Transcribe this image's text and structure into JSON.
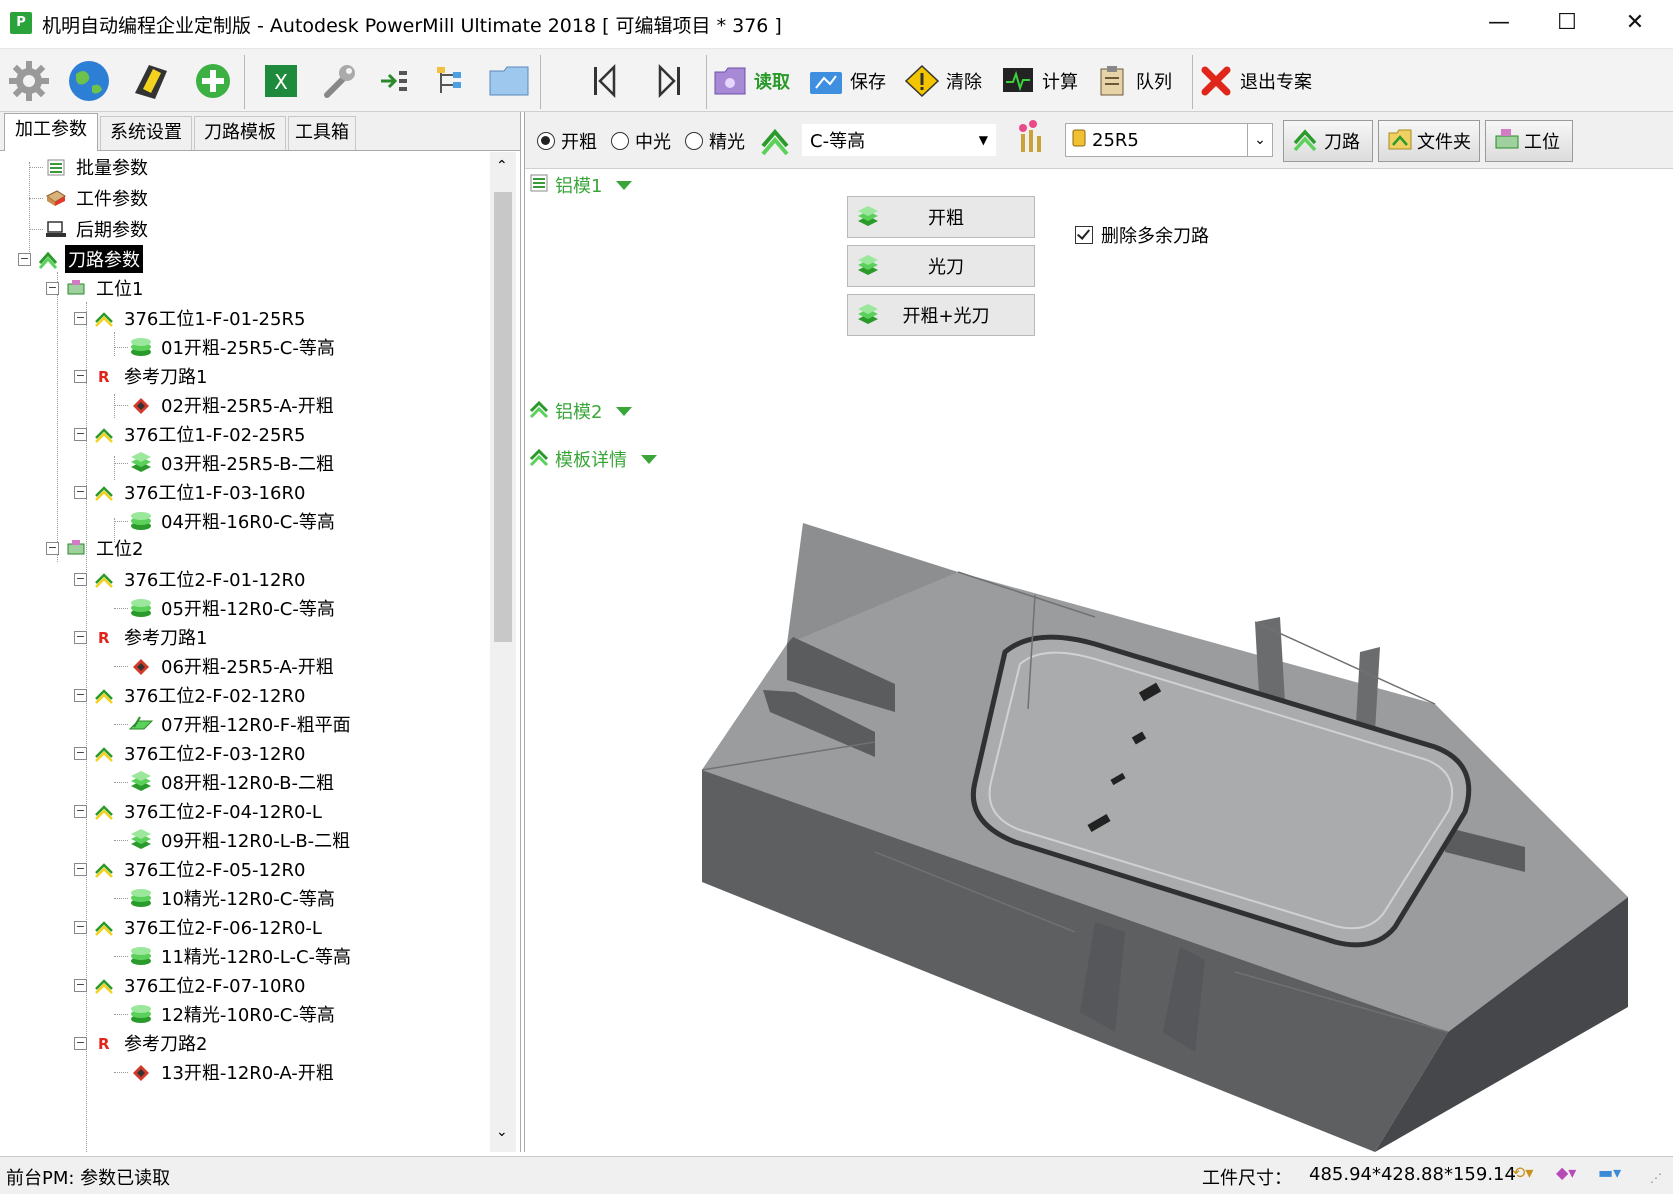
{
  "window": {
    "title": "机明自动编程企业定制版 - Autodesk PowerMill Ultimate 2018    [ 可编辑项目 * 376 ]",
    "minimize": "—",
    "maximize": "☐",
    "close": "✕"
  },
  "toolbar": {
    "read": "读取",
    "save": "保存",
    "clear": "清除",
    "calc": "计算",
    "queue": "队列",
    "exit": "退出专案"
  },
  "tabs": [
    "加工参数",
    "系统设置",
    "刀路模板",
    "工具箱"
  ],
  "tree": {
    "root": [
      "批量参数",
      "工件参数",
      "后期参数",
      "刀路参数"
    ],
    "station1": "工位1",
    "station2": "工位2",
    "items": [
      "376工位1-F-01-25R5",
      "01开粗-25R5-C-等高",
      "参考刀路1",
      "02开粗-25R5-A-开粗",
      "376工位1-F-02-25R5",
      "03开粗-25R5-B-二粗",
      "376工位1-F-03-16R0",
      "04开粗-16R0-C-等高",
      "376工位2-F-01-12R0",
      "05开粗-12R0-C-等高",
      "参考刀路1",
      "06开粗-25R5-A-开粗",
      "376工位2-F-02-12R0",
      "07开粗-12R0-F-粗平面",
      "376工位2-F-03-12R0",
      "08开粗-12R0-B-二粗",
      "376工位2-F-04-12R0-L",
      "09开粗-12R0-L-B-二粗",
      "376工位2-F-05-12R0",
      "10精光-12R0-C-等高",
      "376工位2-F-06-12R0-L",
      "11精光-12R0-L-C-等高",
      "376工位2-F-07-10R0",
      "12精光-10R0-C-等高",
      "参考刀路2",
      "13开粗-12R0-A-开粗"
    ]
  },
  "options": {
    "radio_rough": "开粗",
    "radio_semi": "中光",
    "radio_finish": "精光",
    "strategy": "C-等高",
    "tool": "25R5",
    "btn_toolpath": "刀路",
    "btn_folder": "文件夹",
    "btn_station": "工位"
  },
  "sections": {
    "alu1": "铝模1",
    "alu2": "铝模2",
    "template": "模板详情"
  },
  "actions": [
    "开粗",
    "光刀",
    "开粗+光刀"
  ],
  "checkbox": "删除多余刀路",
  "status": {
    "left": "前台PM: 参数已读取",
    "size_label": "工件尺寸：",
    "size_value": "485.94*428.88*159.14"
  }
}
